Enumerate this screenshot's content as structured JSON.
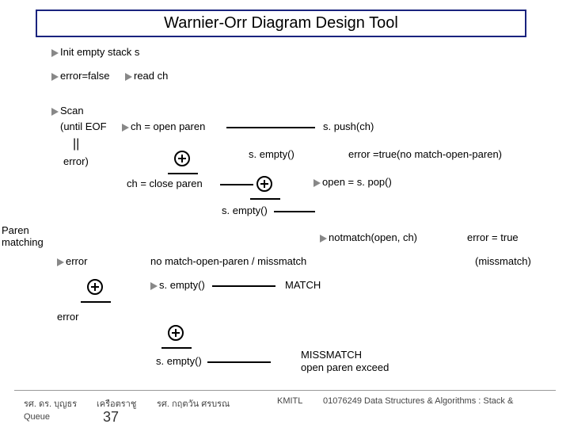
{
  "title": "Warnier-Orr Diagram Design Tool",
  "n": {
    "init": "Init empty stack s",
    "errfalse": "error=false",
    "readch": "read ch",
    "scan": "Scan",
    "until": "(until EOF",
    "or": "||",
    "errclose": "error)",
    "paren": "Paren",
    "matching": "matching",
    "chopen": "ch = open paren",
    "spush": "s. push(ch)",
    "sempty1": "s. empty()",
    "errtrue1": "error =true(no match-open-paren)",
    "chclose": "ch = close paren",
    "opencall": "open = s. pop()",
    "sempty2": "s. empty()",
    "notmatch": "notmatch(open, ch)",
    "errtrue2": "error = true",
    "err1": "error",
    "nomatch": "no match-open-paren / missmatch",
    "missmatch": "(missmatch)",
    "sempty3": "s. empty()",
    "match": "MATCH",
    "err2": "error",
    "sempty4": "s. empty()",
    "miss2": "MISSMATCH",
    "openex": "open paren exceed"
  },
  "footer": {
    "left1": "รศ. ดร. บุญธร",
    "left2": "เครือตราชู",
    "mid": "รศ. กฤตวัน   ศรบรณ",
    "kmitl": "KMITL",
    "course": "01076249 Data Structures & Algorithms : Stack &",
    "queue": "Queue",
    "page": "37"
  }
}
